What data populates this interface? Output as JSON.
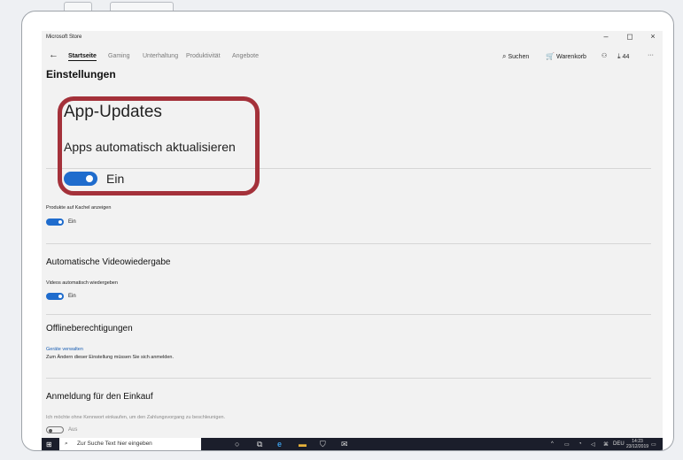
{
  "window": {
    "title": "Microsoft Store",
    "minimize": "–",
    "maximize": "◻",
    "close": "×"
  },
  "nav": {
    "back": "←",
    "tabs": [
      "Startseite",
      "Gaming",
      "Unterhaltung",
      "Produktivität",
      "Angebote"
    ],
    "search": "Suchen",
    "cart": "Warenkorb",
    "downloads": "44",
    "more": "···"
  },
  "page_title": "Einstellungen",
  "app_updates": {
    "title": "App-Updates",
    "label": "Apps automatisch aktualisieren",
    "toggle": "Ein",
    "toggle_on": true
  },
  "tiles": {
    "label": "Produkte auf Kachel anzeigen",
    "toggle": "Ein"
  },
  "video": {
    "title": "Automatische Videowiedergabe",
    "label": "Videos automatisch wiedergeben",
    "toggle": "Ein"
  },
  "offline": {
    "title": "Offlineberechtigungen",
    "link": "Geräte verwalten",
    "note": "Zum Ändern dieser Einstellung müssen Sie sich anmelden."
  },
  "purchase": {
    "title": "Anmeldung für den Einkauf",
    "label": "Ich möchte ohne Kennwort einkaufen, um den Zahlungsvorgang zu beschleunigen.",
    "toggle": "Aus"
  },
  "taskbar": {
    "search_placeholder": "Zur Suche Text hier eingeben",
    "lang": "DEU",
    "time": "14:23",
    "date": "23/12/2019"
  },
  "colors": {
    "accent": "#1f6ccd",
    "highlight": "#a4313a",
    "taskbar": "#1b1e2b"
  }
}
